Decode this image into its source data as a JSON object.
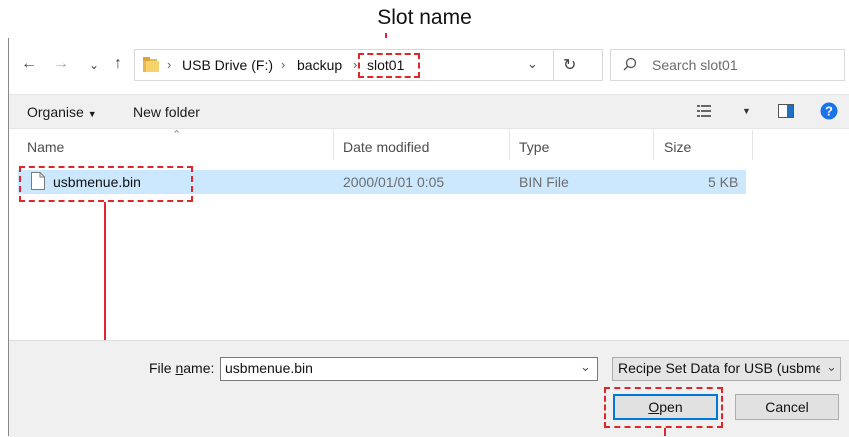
{
  "annotation": {
    "slot_label": "Slot name",
    "color": "#e0262b"
  },
  "nav": {
    "back_icon": "arrow-left-icon",
    "forward_icon": "arrow-right-icon",
    "recent_icon": "chevron-down-icon",
    "up_icon": "arrow-up-icon"
  },
  "address": {
    "crumbs": [
      "USB Drive (F:)",
      "backup",
      "slot01"
    ]
  },
  "search": {
    "placeholder": "Search slot01"
  },
  "toolbar": {
    "organise": "Organise",
    "new_folder": "New folder"
  },
  "columns": {
    "name": "Name",
    "date": "Date modified",
    "type": "Type",
    "size": "Size"
  },
  "files": [
    {
      "name": "usbmenue.bin",
      "date": "2000/01/01 0:05",
      "type": "BIN File",
      "size": "5 KB"
    }
  ],
  "footer": {
    "filename_label_pre": "File ",
    "filename_label_key": "n",
    "filename_label_post": "ame:",
    "filename_value": "usbmenue.bin",
    "filter_value": "Recipe Set Data for USB (usbme",
    "open_label_key": "O",
    "open_label_rest": "pen",
    "cancel_label": "Cancel"
  },
  "colors": {
    "selection": "#cce8ff",
    "accent": "#0078d7",
    "help": "#1a73e8"
  }
}
